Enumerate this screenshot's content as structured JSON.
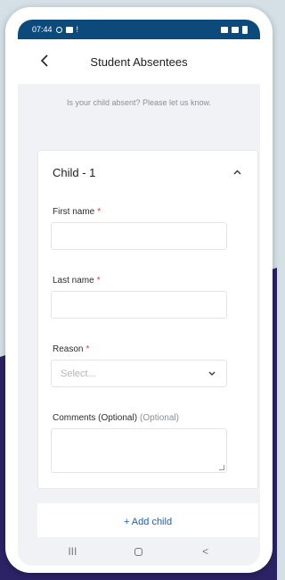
{
  "status_bar": {
    "time": "07:44"
  },
  "header": {
    "title": "Student Absentees",
    "back_icon": "chevron-left-icon"
  },
  "intro": "Is your child absent? Please let us know.",
  "child_card": {
    "title": "Child - 1",
    "collapse_icon": "chevron-up-icon",
    "fields": {
      "first_name": {
        "label": "First name",
        "required": "*",
        "value": ""
      },
      "last_name": {
        "label": "Last name",
        "required": "*",
        "value": ""
      },
      "reason": {
        "label": "Reason",
        "required": "*",
        "placeholder": "Select..."
      },
      "comments": {
        "label": "Comments (Optional)",
        "optional": "(Optional)",
        "value": ""
      }
    }
  },
  "add_child": "+ Add child",
  "nav": {
    "recents": "III",
    "back": "<"
  },
  "colors": {
    "status_bar": "#0d4a7c",
    "link": "#1f5fae",
    "required": "#e23b3b",
    "background_dark": "#2b2366"
  }
}
